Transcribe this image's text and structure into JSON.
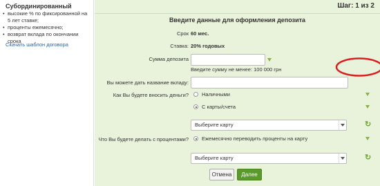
{
  "sidebar": {
    "title": "Субординированный",
    "items": [
      "высокие % по фиксированной на 5 лет ставке;",
      "проценты ежемесячно;",
      "возврат вклада по окончании срока"
    ],
    "link": "Скачать шаблон договора"
  },
  "step": "Шаг: 1 из 2",
  "form": {
    "title": "Введите данные для оформления депозита",
    "term_label": "Срок",
    "term_value": "60 мес.",
    "rate_label": "Ставка:",
    "rate_value": "20% годовых",
    "amount_label": "Сумма депозита",
    "amount_value": "",
    "amount_hint": "Введите сумму не менее: 100 000 грн",
    "name_label": "Вы можете дать название вкладу:",
    "name_value": "",
    "deposit_method_label": "Как Вы будете вносить деньги?",
    "deposit_options": [
      "Наличными",
      "С карты/счета"
    ],
    "deposit_selected": 1,
    "card_select_1": "Выберите карту",
    "interest_label": "Что Вы будете делать с процентами?",
    "interest_option": "Ежемесячно переводить проценты на карту",
    "card_select_2": "Выберите карту",
    "cancel_label": "Отмена",
    "next_label": "Далее"
  },
  "colors": {
    "panel_bg": "#e9f2da",
    "accent_green": "#5a9a2a",
    "annotation_red": "#d82020",
    "link_blue": "#2a62b2"
  }
}
